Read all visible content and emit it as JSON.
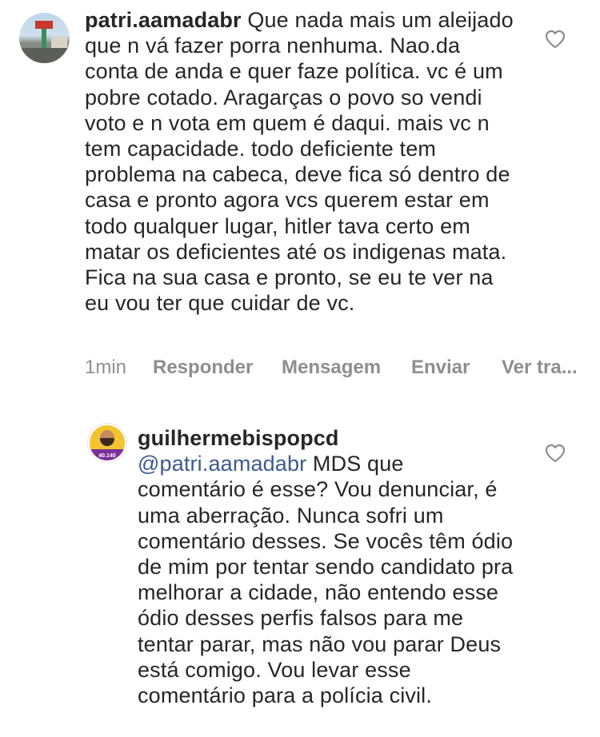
{
  "comment_1": {
    "username": "patri.aamadabr",
    "text": "Que nada mais um aleijado que n vá fazer porra nenhuma. Nao.da conta de anda e quer faze política. vc é um pobre cotado. Aragarças o povo so vendi voto e n vota em quem é daqui. mais vc n tem capacidade. todo deficiente tem problema na cabeca, deve fica só dentro de casa e pronto agora vcs querem estar em todo qualquer lugar, hitler tava certo em matar os deficientes até os indigenas mata. Fica na sua casa e pronto, se eu te ver na eu vou ter que cuidar de vc.",
    "like_icon": "heart-outline-icon",
    "meta": {
      "time": "1min",
      "reply": "Responder",
      "message": "Mensagem",
      "send": "Enviar",
      "translate": "Ver tra..."
    }
  },
  "comment_2": {
    "username": "guilhermebispopcd",
    "mention": "@patri.aamadabr",
    "text": "MDS que comentário é esse? Vou denunciar, é uma aberração. Nunca sofri um comentário desses. Se vocês têm ódio de mim por tentar sendo candidato pra melhorar a cidade, não entendo esse ódio desses perfis falsos para me tentar parar, mas não vou parar Deus está comigo. Vou levar esse comentário para a polícia civil.",
    "avatar_badge": "40.140",
    "like_icon": "heart-outline-icon"
  }
}
